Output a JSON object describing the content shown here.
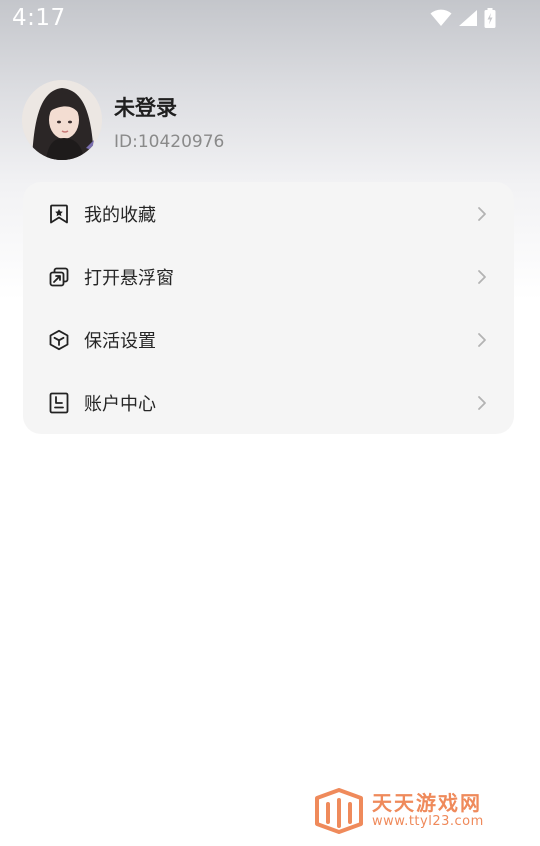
{
  "status_bar": {
    "time": "4:17"
  },
  "profile": {
    "name": "未登录",
    "id_text": "ID:10420976"
  },
  "menu": {
    "items": [
      {
        "label": "我的收藏",
        "icon": "bookmark-icon"
      },
      {
        "label": "打开悬浮窗",
        "icon": "floating-window-icon"
      },
      {
        "label": "保活设置",
        "icon": "cube-icon"
      },
      {
        "label": "账户中心",
        "icon": "account-book-icon"
      }
    ]
  },
  "watermark": {
    "title": "天天游戏网",
    "url": "www.ttyl23.com"
  },
  "colors": {
    "accent_watermark": "#ef8a5b",
    "card_background": "#f5f5f5",
    "text_primary": "#262626",
    "text_secondary": "#8a8a8a"
  }
}
